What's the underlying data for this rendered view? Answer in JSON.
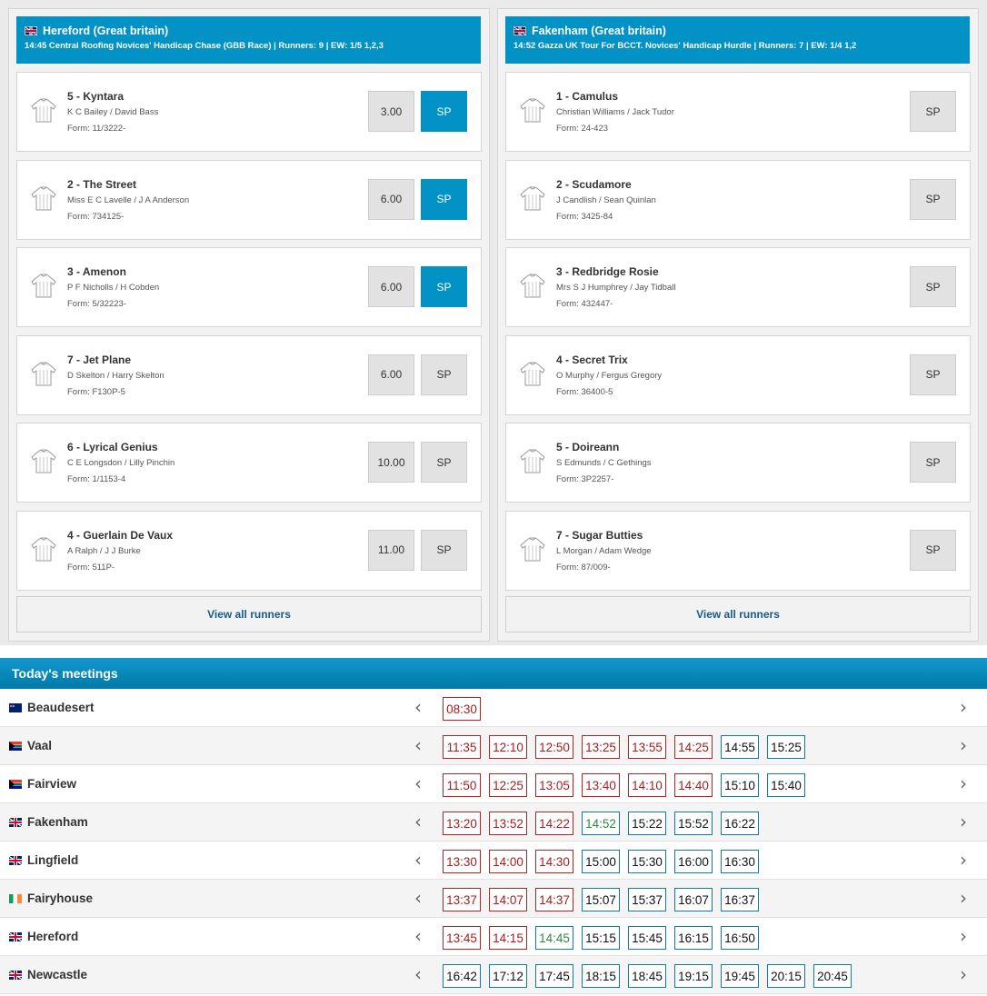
{
  "races": [
    {
      "flag": "uk",
      "course": "Hereford (Great britain)",
      "subtitle": "14:45 Central Roofing Novices' Handicap Chase (GBB Race) | Runners: 9 | EW: 1/5 1,2,3",
      "runners": [
        {
          "name": "5 - Kyntara",
          "connections": "K C Bailey / David Bass",
          "form": "Form: 11/3222-",
          "price": "3.00",
          "sp": "SP",
          "sp_active": true
        },
        {
          "name": "2 - The Street",
          "connections": "Miss E C Lavelle / J A Anderson",
          "form": "Form: 734125-",
          "price": "6.00",
          "sp": "SP",
          "sp_active": true
        },
        {
          "name": "3 - Amenon",
          "connections": "P F Nicholls / H Cobden",
          "form": "Form: 5/32223-",
          "price": "6.00",
          "sp": "SP",
          "sp_active": true
        },
        {
          "name": "7 - Jet Plane",
          "connections": "D Skelton / Harry Skelton",
          "form": "Form: F130P-5",
          "price": "6.00",
          "sp": "SP",
          "sp_active": false
        },
        {
          "name": "6 - Lyrical Genius",
          "connections": "C E Longsdon / Lilly Pinchin",
          "form": "Form: 1/1153-4",
          "price": "10.00",
          "sp": "SP",
          "sp_active": false
        },
        {
          "name": "4 - Guerlain De Vaux",
          "connections": "A Ralph / J J Burke",
          "form": "Form: 511P-",
          "price": "11.00",
          "sp": "SP",
          "sp_active": false
        }
      ],
      "view_all": "View all runners"
    },
    {
      "flag": "uk",
      "course": "Fakenham (Great britain)",
      "subtitle": "14:52 Gazza UK Tour For BCCT. Novices' Handicap Hurdle | Runners: 7 | EW: 1/4 1,2",
      "runners": [
        {
          "name": "1 - Camulus",
          "connections": "Christian Williams / Jack Tudor",
          "form": "Form: 24-423",
          "price": "",
          "sp": "SP",
          "sp_active": false
        },
        {
          "name": "2 - Scudamore",
          "connections": "J Candlish / Sean Quinlan",
          "form": "Form: 3425-84",
          "price": "",
          "sp": "SP",
          "sp_active": false
        },
        {
          "name": "3 - Redbridge Rosie",
          "connections": "Mrs S J Humphrey / Jay Tidball",
          "form": "Form: 432447-",
          "price": "",
          "sp": "SP",
          "sp_active": false
        },
        {
          "name": "4 - Secret Trix",
          "connections": "O Murphy / Fergus Gregory",
          "form": "Form: 36400-5",
          "price": "",
          "sp": "SP",
          "sp_active": false
        },
        {
          "name": "5 - Doireann",
          "connections": "S Edmunds / C Gethings",
          "form": "Form: 3P2257-",
          "price": "",
          "sp": "SP",
          "sp_active": false
        },
        {
          "name": "7 - Sugar Butties",
          "connections": "L Morgan / Adam Wedge",
          "form": "Form: 87/009-",
          "price": "",
          "sp": "SP",
          "sp_active": false
        }
      ],
      "view_all": "View all runners"
    }
  ],
  "meetings": {
    "title": "Today's meetings",
    "prev_icon": "chevron-left-icon",
    "next_icon": "chevron-right-icon",
    "rows": [
      {
        "flag": "au",
        "name": "Beaudesert",
        "times": [
          {
            "t": "08:30",
            "s": "past"
          }
        ]
      },
      {
        "flag": "za",
        "name": "Vaal",
        "times": [
          {
            "t": "11:35",
            "s": "past"
          },
          {
            "t": "12:10",
            "s": "past"
          },
          {
            "t": "12:50",
            "s": "past"
          },
          {
            "t": "13:25",
            "s": "past"
          },
          {
            "t": "13:55",
            "s": "past"
          },
          {
            "t": "14:25",
            "s": "past"
          },
          {
            "t": "14:55",
            "s": "upcoming"
          },
          {
            "t": "15:25",
            "s": "upcoming"
          }
        ]
      },
      {
        "flag": "za",
        "name": "Fairview",
        "times": [
          {
            "t": "11:50",
            "s": "past"
          },
          {
            "t": "12:25",
            "s": "past"
          },
          {
            "t": "13:05",
            "s": "past"
          },
          {
            "t": "13:40",
            "s": "past"
          },
          {
            "t": "14:10",
            "s": "past"
          },
          {
            "t": "14:40",
            "s": "past"
          },
          {
            "t": "15:10",
            "s": "upcoming"
          },
          {
            "t": "15:40",
            "s": "upcoming"
          }
        ]
      },
      {
        "flag": "uk",
        "name": "Fakenham",
        "times": [
          {
            "t": "13:20",
            "s": "past"
          },
          {
            "t": "13:52",
            "s": "past"
          },
          {
            "t": "14:22",
            "s": "past"
          },
          {
            "t": "14:52",
            "s": "live"
          },
          {
            "t": "15:22",
            "s": "upcoming"
          },
          {
            "t": "15:52",
            "s": "upcoming"
          },
          {
            "t": "16:22",
            "s": "upcoming"
          }
        ]
      },
      {
        "flag": "uk",
        "name": "Lingfield",
        "times": [
          {
            "t": "13:30",
            "s": "past"
          },
          {
            "t": "14:00",
            "s": "past"
          },
          {
            "t": "14:30",
            "s": "past"
          },
          {
            "t": "15:00",
            "s": "upcoming"
          },
          {
            "t": "15:30",
            "s": "upcoming"
          },
          {
            "t": "16:00",
            "s": "upcoming"
          },
          {
            "t": "16:30",
            "s": "upcoming"
          }
        ]
      },
      {
        "flag": "ie",
        "name": "Fairyhouse",
        "times": [
          {
            "t": "13:37",
            "s": "past"
          },
          {
            "t": "14:07",
            "s": "past"
          },
          {
            "t": "14:37",
            "s": "past"
          },
          {
            "t": "15:07",
            "s": "upcoming"
          },
          {
            "t": "15:37",
            "s": "upcoming"
          },
          {
            "t": "16:07",
            "s": "upcoming"
          },
          {
            "t": "16:37",
            "s": "upcoming"
          }
        ]
      },
      {
        "flag": "uk",
        "name": "Hereford",
        "times": [
          {
            "t": "13:45",
            "s": "past"
          },
          {
            "t": "14:15",
            "s": "past"
          },
          {
            "t": "14:45",
            "s": "live"
          },
          {
            "t": "15:15",
            "s": "upcoming"
          },
          {
            "t": "15:45",
            "s": "upcoming"
          },
          {
            "t": "16:15",
            "s": "upcoming"
          },
          {
            "t": "16:50",
            "s": "upcoming"
          }
        ]
      },
      {
        "flag": "uk",
        "name": "Newcastle",
        "times": [
          {
            "t": "16:42",
            "s": "upcoming"
          },
          {
            "t": "17:12",
            "s": "upcoming"
          },
          {
            "t": "17:45",
            "s": "upcoming"
          },
          {
            "t": "18:15",
            "s": "upcoming"
          },
          {
            "t": "18:45",
            "s": "upcoming"
          },
          {
            "t": "19:15",
            "s": "upcoming"
          },
          {
            "t": "19:45",
            "s": "upcoming"
          },
          {
            "t": "20:15",
            "s": "upcoming"
          },
          {
            "t": "20:45",
            "s": "upcoming"
          }
        ]
      }
    ]
  }
}
